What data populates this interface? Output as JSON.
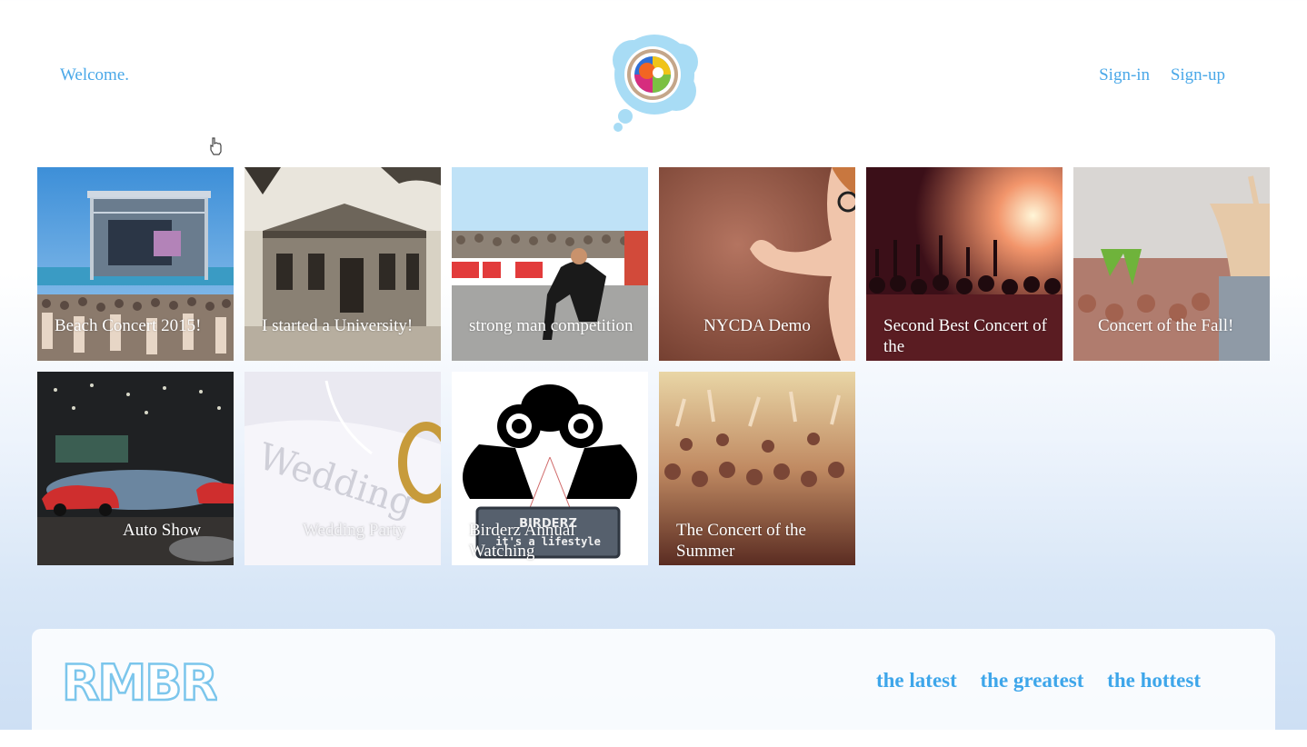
{
  "header": {
    "welcome": "Welcome.",
    "signin": "Sign-in",
    "signup": "Sign-up"
  },
  "tiles": [
    {
      "label": "Beach Concert 2015!"
    },
    {
      "label": "I started a University!"
    },
    {
      "label": "strong man competition"
    },
    {
      "label": "NYCDA Demo"
    },
    {
      "label": "Second Best Concert of the"
    },
    {
      "label": "Concert of the Fall!"
    },
    {
      "label": "Auto Show"
    },
    {
      "label": "Wedding Party"
    },
    {
      "label": "Birderz Annual Watching"
    },
    {
      "label": "The Concert of the Summer"
    }
  ],
  "tile_art": {
    "birderz_sign": "BIRDERZ",
    "birderz_tagline": "it's a lifestyle"
  },
  "footer": {
    "logo_text": "RMBR",
    "nav": [
      "the latest",
      "the greatest",
      "the hottest"
    ]
  },
  "colors": {
    "accent": "#4aa8e8",
    "footer_link": "#3ea6ea"
  }
}
